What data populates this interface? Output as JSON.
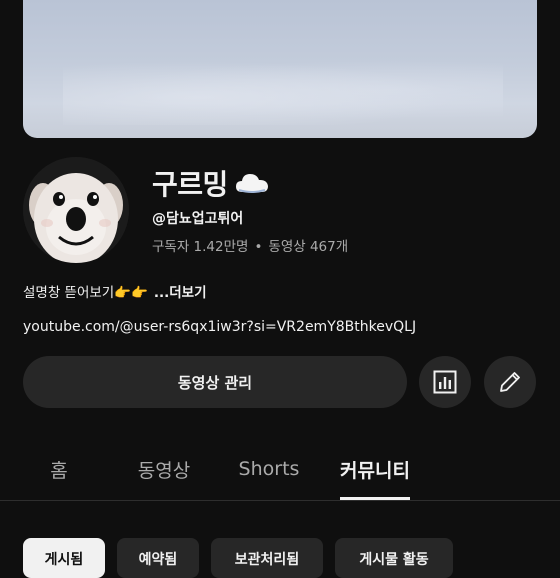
{
  "channel": {
    "name": "구르밍",
    "name_emoji_icon": "cloud-icon",
    "handle": "@담뇨업고튀어",
    "subscribers": "구독자 1.42만명",
    "separator": "•",
    "videos": "동영상 467개",
    "description": "설명창 뜯어보기👉👉",
    "more_label": "...더보기",
    "link": "youtube.com/@user-rs6qx1iw3r?si=VR2emY8BthkevQLJ"
  },
  "actions": {
    "manage_videos_label": "동영상 관리",
    "analytics_icon": "analytics-icon",
    "edit_icon": "pencil-icon"
  },
  "tabs": [
    {
      "label": "홈"
    },
    {
      "label": "동영상"
    },
    {
      "label": "Shorts"
    },
    {
      "label": "커뮤니티",
      "active": true
    }
  ],
  "chips": [
    {
      "label": "게시됨",
      "active": true
    },
    {
      "label": "예약됨"
    },
    {
      "label": "보관처리됨"
    },
    {
      "label": "게시물 활동"
    }
  ],
  "colors": {
    "background": "#0f0f0f",
    "button": "#272727",
    "text": "#f1f1f1",
    "muted": "#aaaaaa"
  }
}
